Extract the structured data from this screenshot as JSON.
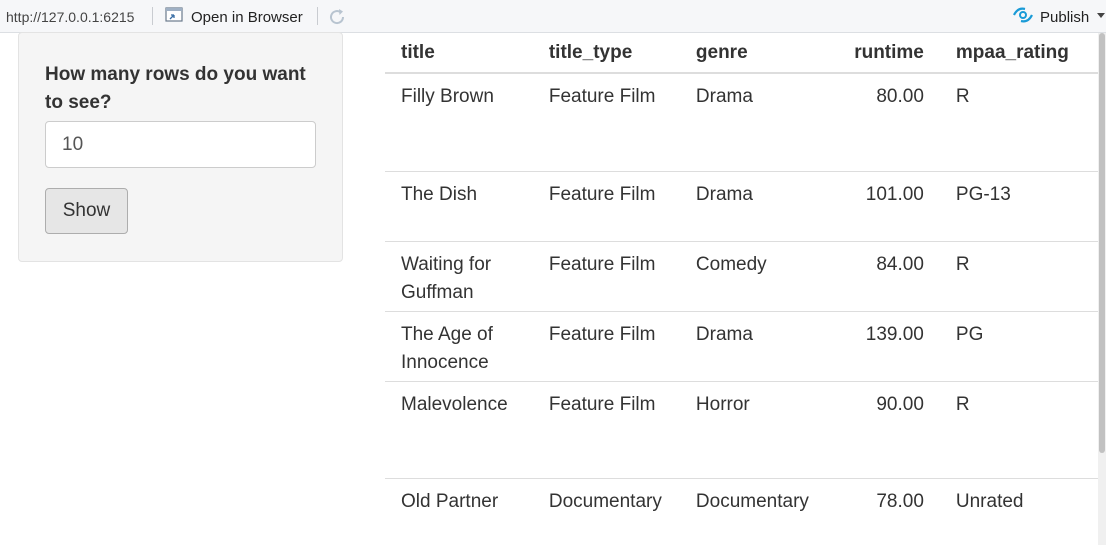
{
  "toolbar": {
    "url": "http://127.0.0.1:6215",
    "open_in_browser": "Open in Browser",
    "publish": "Publish"
  },
  "sidebar": {
    "label": "How many rows do you want to see?",
    "input_value": "10",
    "button": "Show"
  },
  "table": {
    "headers": [
      "title",
      "title_type",
      "genre",
      "runtime",
      "mpaa_rating"
    ],
    "rows": [
      {
        "title": "Filly Brown",
        "title_type": "Feature Film",
        "genre": "Drama",
        "runtime": "80.00",
        "mpaa_rating": "R"
      },
      {
        "title": "The Dish",
        "title_type": "Feature Film",
        "genre": "Drama",
        "runtime": "101.00",
        "mpaa_rating": "PG-13"
      },
      {
        "title": "Waiting for Guffman",
        "title_type": "Feature Film",
        "genre": "Comedy",
        "runtime": "84.00",
        "mpaa_rating": "R"
      },
      {
        "title": "The Age of Innocence",
        "title_type": "Feature Film",
        "genre": "Drama",
        "runtime": "139.00",
        "mpaa_rating": "PG"
      },
      {
        "title": "Malevolence",
        "title_type": "Feature Film",
        "genre": "Horror",
        "runtime": "90.00",
        "mpaa_rating": "R"
      },
      {
        "title": "Old Partner",
        "title_type": "Documentary",
        "genre": "Documentary",
        "runtime": "78.00",
        "mpaa_rating": "Unrated"
      }
    ]
  },
  "colors": {
    "publish_icon": "#1a9bd7",
    "well_bg": "#f5f5f5"
  }
}
